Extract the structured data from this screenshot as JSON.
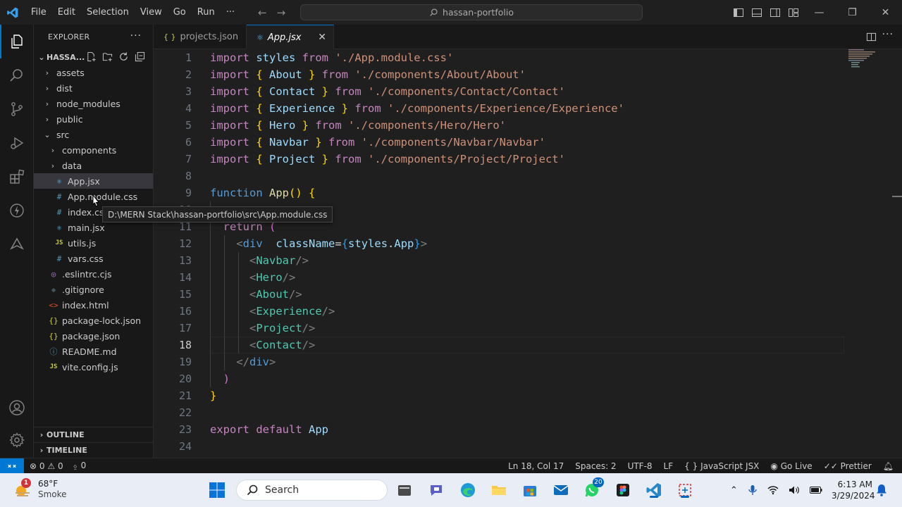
{
  "titlebar": {
    "menu": [
      "File",
      "Edit",
      "Selection",
      "View",
      "Go",
      "Run",
      "···"
    ],
    "search_text": "hassan-portfolio"
  },
  "sidebar": {
    "title": "EXPLORER",
    "folder_name": "HASSA...",
    "tree": [
      {
        "label": "assets",
        "type": "folder",
        "depth": 0,
        "open": false
      },
      {
        "label": "dist",
        "type": "folder",
        "depth": 0,
        "open": false
      },
      {
        "label": "node_modules",
        "type": "folder",
        "depth": 0,
        "open": false
      },
      {
        "label": "public",
        "type": "folder",
        "depth": 0,
        "open": false
      },
      {
        "label": "src",
        "type": "folder",
        "depth": 0,
        "open": true
      },
      {
        "label": "components",
        "type": "folder",
        "depth": 1,
        "open": false
      },
      {
        "label": "data",
        "type": "folder",
        "depth": 1,
        "open": false
      },
      {
        "label": "App.jsx",
        "type": "react",
        "depth": 1,
        "selected": true
      },
      {
        "label": "App.module.css",
        "type": "css",
        "depth": 1
      },
      {
        "label": "index.css",
        "type": "css",
        "depth": 1
      },
      {
        "label": "main.jsx",
        "type": "react",
        "depth": 1
      },
      {
        "label": "utils.js",
        "type": "js",
        "depth": 1
      },
      {
        "label": "vars.css",
        "type": "css",
        "depth": 1
      },
      {
        "label": ".eslintrc.cjs",
        "type": "eslint",
        "depth": 0
      },
      {
        "label": ".gitignore",
        "type": "git",
        "depth": 0
      },
      {
        "label": "index.html",
        "type": "html",
        "depth": 0
      },
      {
        "label": "package-lock.json",
        "type": "json",
        "depth": 0
      },
      {
        "label": "package.json",
        "type": "json",
        "depth": 0
      },
      {
        "label": "README.md",
        "type": "info",
        "depth": 0
      },
      {
        "label": "vite.config.js",
        "type": "js",
        "depth": 0
      }
    ],
    "outline_label": "OUTLINE",
    "timeline_label": "TIMELINE"
  },
  "tooltip": "D:\\MERN Stack\\hassan-portfolio\\src\\App.module.css",
  "tabs": [
    {
      "label": "projects.json",
      "icon": "{ }",
      "active": false
    },
    {
      "label": "App.jsx",
      "icon": "⚛",
      "active": true,
      "close": "✕"
    }
  ],
  "editor": {
    "current_line": 18,
    "lines": [
      {
        "n": "1",
        "tokens": [
          [
            "kw",
            "import "
          ],
          [
            "id",
            "styles "
          ],
          [
            "kw",
            "from "
          ],
          [
            "str",
            "'./App.module.css'"
          ]
        ]
      },
      {
        "n": "2",
        "tokens": [
          [
            "kw",
            "import "
          ],
          [
            "br1",
            "{ "
          ],
          [
            "id",
            "About "
          ],
          [
            "br1",
            "} "
          ],
          [
            "kw",
            "from "
          ],
          [
            "str",
            "'./components/About/About'"
          ]
        ]
      },
      {
        "n": "3",
        "tokens": [
          [
            "kw",
            "import "
          ],
          [
            "br1",
            "{ "
          ],
          [
            "id",
            "Contact "
          ],
          [
            "br1",
            "} "
          ],
          [
            "kw",
            "from "
          ],
          [
            "str",
            "'./components/Contact/Contact'"
          ]
        ]
      },
      {
        "n": "4",
        "tokens": [
          [
            "kw",
            "import "
          ],
          [
            "br1",
            "{ "
          ],
          [
            "id",
            "Experience "
          ],
          [
            "br1",
            "} "
          ],
          [
            "kw",
            "from "
          ],
          [
            "str",
            "'./components/Experience/Experience'"
          ]
        ]
      },
      {
        "n": "5",
        "tokens": [
          [
            "kw",
            "import "
          ],
          [
            "br1",
            "{ "
          ],
          [
            "id",
            "Hero "
          ],
          [
            "br1",
            "} "
          ],
          [
            "kw",
            "from "
          ],
          [
            "str",
            "'./components/Hero/Hero'"
          ]
        ]
      },
      {
        "n": "6",
        "tokens": [
          [
            "kw",
            "import "
          ],
          [
            "br1",
            "{ "
          ],
          [
            "id",
            "Navbar "
          ],
          [
            "br1",
            "} "
          ],
          [
            "kw",
            "from "
          ],
          [
            "str",
            "'./components/Navbar/Navbar'"
          ]
        ]
      },
      {
        "n": "7",
        "tokens": [
          [
            "kw",
            "import "
          ],
          [
            "br1",
            "{ "
          ],
          [
            "id",
            "Project "
          ],
          [
            "br1",
            "} "
          ],
          [
            "kw",
            "from "
          ],
          [
            "str",
            "'./components/Project/Project'"
          ]
        ]
      },
      {
        "n": "8",
        "tokens": []
      },
      {
        "n": "9",
        "tokens": [
          [
            "kwb",
            "function "
          ],
          [
            "fn",
            "App"
          ],
          [
            "br1",
            "() {"
          ]
        ]
      },
      {
        "n": "10",
        "tokens": []
      },
      {
        "n": "11",
        "tokens": [
          [
            "plain",
            "  "
          ],
          [
            "kw",
            "return "
          ],
          [
            "br2",
            "("
          ]
        ]
      },
      {
        "n": "12",
        "tokens": [
          [
            "plain",
            "    "
          ],
          [
            "ang",
            "<"
          ],
          [
            "kwb",
            "div  "
          ],
          [
            "attr",
            "className"
          ],
          [
            "plain",
            "="
          ],
          [
            "br3",
            "{"
          ],
          [
            "id",
            "styles"
          ],
          [
            "plain",
            "."
          ],
          [
            "id",
            "App"
          ],
          [
            "br3",
            "}"
          ],
          [
            "ang",
            ">"
          ]
        ]
      },
      {
        "n": "13",
        "tokens": [
          [
            "plain",
            "      "
          ],
          [
            "ang",
            "<"
          ],
          [
            "tag",
            "Navbar"
          ],
          [
            "ang",
            "/>"
          ]
        ]
      },
      {
        "n": "14",
        "tokens": [
          [
            "plain",
            "      "
          ],
          [
            "ang",
            "<"
          ],
          [
            "tag",
            "Hero"
          ],
          [
            "ang",
            "/>"
          ]
        ]
      },
      {
        "n": "15",
        "tokens": [
          [
            "plain",
            "      "
          ],
          [
            "ang",
            "<"
          ],
          [
            "tag",
            "About"
          ],
          [
            "ang",
            "/>"
          ]
        ]
      },
      {
        "n": "16",
        "tokens": [
          [
            "plain",
            "      "
          ],
          [
            "ang",
            "<"
          ],
          [
            "tag",
            "Experience"
          ],
          [
            "ang",
            "/>"
          ]
        ]
      },
      {
        "n": "17",
        "tokens": [
          [
            "plain",
            "      "
          ],
          [
            "ang",
            "<"
          ],
          [
            "tag",
            "Project"
          ],
          [
            "ang",
            "/>"
          ]
        ]
      },
      {
        "n": "18",
        "tokens": [
          [
            "plain",
            "      "
          ],
          [
            "ang",
            "<"
          ],
          [
            "tag",
            "Contact"
          ],
          [
            "ang",
            "/>"
          ]
        ]
      },
      {
        "n": "19",
        "tokens": [
          [
            "plain",
            "    "
          ],
          [
            "ang",
            "</"
          ],
          [
            "kwb",
            "div"
          ],
          [
            "ang",
            ">"
          ]
        ]
      },
      {
        "n": "20",
        "tokens": [
          [
            "plain",
            "  "
          ],
          [
            "br2",
            ")"
          ]
        ]
      },
      {
        "n": "21",
        "tokens": [
          [
            "br1",
            "}"
          ]
        ]
      },
      {
        "n": "22",
        "tokens": []
      },
      {
        "n": "23",
        "tokens": [
          [
            "kw",
            "export "
          ],
          [
            "kw",
            "default "
          ],
          [
            "id",
            "App"
          ]
        ]
      },
      {
        "n": "24",
        "tokens": []
      }
    ]
  },
  "statusbar": {
    "errors": "0",
    "warnings": "0",
    "ports": "0",
    "position": "Ln 18, Col 17",
    "spaces": "Spaces: 2",
    "encoding": "UTF-8",
    "eol": "LF",
    "language": "JavaScript JSX",
    "golive": "Go Live",
    "prettier": "Prettier"
  },
  "taskbar": {
    "weather_badge": "1",
    "temp": "68°F",
    "condition": "Smoke",
    "search_placeholder": "Search",
    "whatsapp_badge": "20",
    "time": "6:13 AM",
    "date": "3/29/2024"
  },
  "colors": {
    "accent": "#0078d4",
    "editor_bg": "#1f1f1f",
    "sidebar_bg": "#181818"
  }
}
